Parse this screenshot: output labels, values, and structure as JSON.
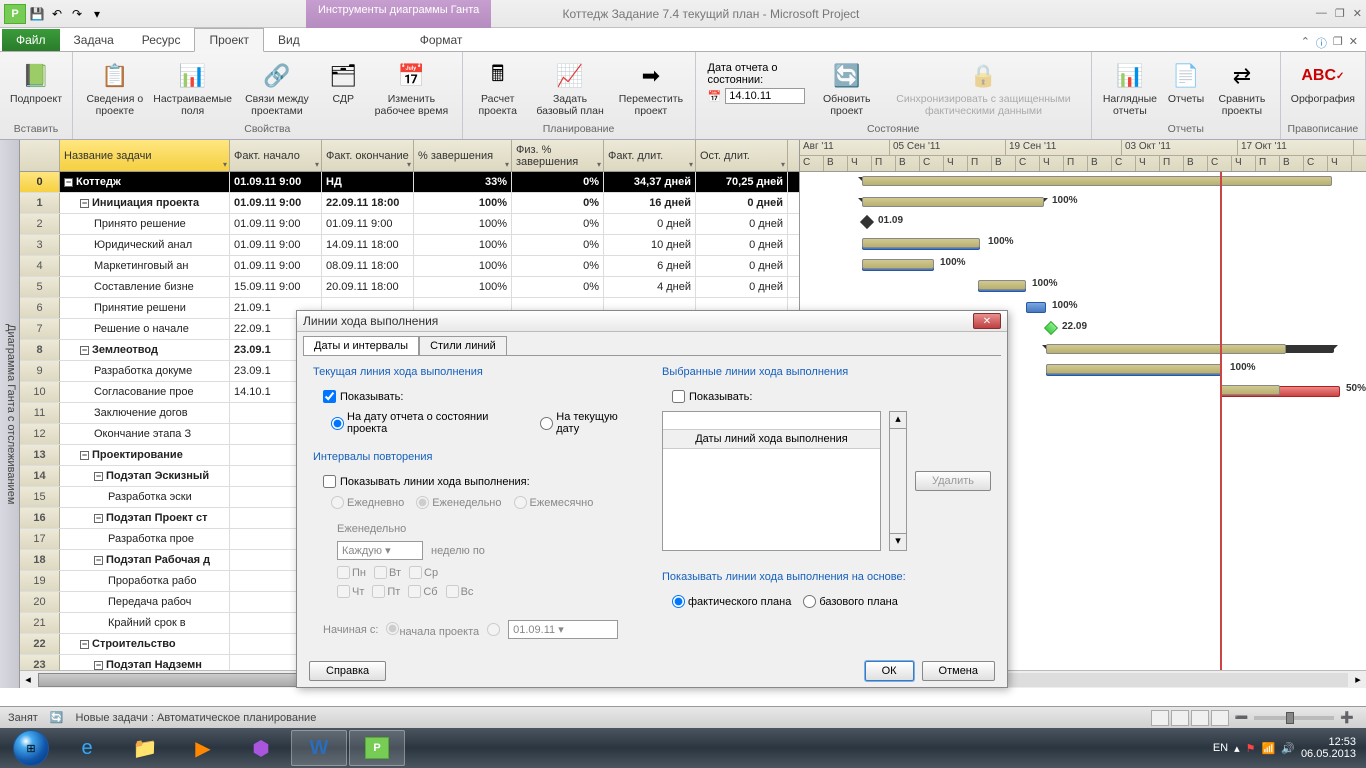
{
  "title": "Коттедж Задание 7.4 текущий план - Microsoft Project",
  "context_tab": "Инструменты диаграммы Ганта",
  "tabs": {
    "file": "Файл",
    "task": "Задача",
    "resource": "Ресурс",
    "project": "Проект",
    "view": "Вид",
    "format": "Формат"
  },
  "ribbon": {
    "insert_group": "Вставить",
    "subproject": "Подпроект",
    "props_group": "Свойства",
    "info": "Сведения о проекте",
    "custom_fields": "Настраиваемые поля",
    "links": "Связи между проектами",
    "wbs": "СДР",
    "change_time": "Изменить рабочее время",
    "plan_group": "Планирование",
    "calc": "Расчет проекта",
    "baseline": "Задать базовый план",
    "move": "Переместить проект",
    "status_label": "Дата отчета о состоянии:",
    "status_date": "14.10.11",
    "status_group": "Состояние",
    "update": "Обновить проект",
    "sync": "Синхронизировать с защищенными фактическими данными",
    "reports_group": "Отчеты",
    "visual": "Наглядные отчеты",
    "reports": "Отчеты",
    "compare": "Сравнить проекты",
    "spell_group": "Правописание",
    "spell": "Орфография"
  },
  "sidebar": "Диаграмма Ганта с отслеживанием",
  "columns": {
    "name": "Название задачи",
    "c1": "Факт. начало",
    "c2": "Факт. окончание",
    "c3": "% завершения",
    "c4": "Физ. % завершения",
    "c5": "Факт. длит.",
    "c6": "Ост. длит."
  },
  "rows": [
    {
      "n": "0",
      "name": "Коттедж",
      "c1": "01.09.11 9:00",
      "c2": "НД",
      "c3": "33%",
      "c4": "0%",
      "c5": "34,37 дней",
      "c6": "70,25 дней",
      "lvl": 0,
      "sum": true,
      "black": true
    },
    {
      "n": "1",
      "name": "Инициация проекта",
      "c1": "01.09.11 9:00",
      "c2": "22.09.11 18:00",
      "c3": "100%",
      "c4": "0%",
      "c5": "16 дней",
      "c6": "0 дней",
      "lvl": 1,
      "sum": true
    },
    {
      "n": "2",
      "name": "Принято решение",
      "c1": "01.09.11 9:00",
      "c2": "01.09.11 9:00",
      "c3": "100%",
      "c4": "0%",
      "c5": "0 дней",
      "c6": "0 дней",
      "lvl": 2
    },
    {
      "n": "3",
      "name": "Юридический анал",
      "c1": "01.09.11 9:00",
      "c2": "14.09.11 18:00",
      "c3": "100%",
      "c4": "0%",
      "c5": "10 дней",
      "c6": "0 дней",
      "lvl": 2
    },
    {
      "n": "4",
      "name": "Маркетинговый ан",
      "c1": "01.09.11 9:00",
      "c2": "08.09.11 18:00",
      "c3": "100%",
      "c4": "0%",
      "c5": "6 дней",
      "c6": "0 дней",
      "lvl": 2
    },
    {
      "n": "5",
      "name": "Составление бизне",
      "c1": "15.09.11 9:00",
      "c2": "20.09.11 18:00",
      "c3": "100%",
      "c4": "0%",
      "c5": "4 дней",
      "c6": "0 дней",
      "lvl": 2
    },
    {
      "n": "6",
      "name": "Принятие решени",
      "c1": "21.09.1",
      "c2": "",
      "c3": "",
      "c4": "",
      "c5": "",
      "c6": "",
      "lvl": 2
    },
    {
      "n": "7",
      "name": "Решение о начале",
      "c1": "22.09.1",
      "c2": "",
      "c3": "",
      "c4": "",
      "c5": "",
      "c6": "",
      "lvl": 2
    },
    {
      "n": "8",
      "name": "Землеотвод",
      "c1": "23.09.1",
      "c2": "",
      "c3": "",
      "c4": "",
      "c5": "",
      "c6": "",
      "lvl": 1,
      "sum": true
    },
    {
      "n": "9",
      "name": "Разработка докуме",
      "c1": "23.09.1",
      "c2": "",
      "c3": "",
      "c4": "",
      "c5": "",
      "c6": "",
      "lvl": 2
    },
    {
      "n": "10",
      "name": "Согласование прое",
      "c1": "14.10.1",
      "c2": "",
      "c3": "",
      "c4": "",
      "c5": "",
      "c6": "",
      "lvl": 2
    },
    {
      "n": "11",
      "name": "Заключение догов",
      "c1": "",
      "c2": "",
      "c3": "",
      "c4": "",
      "c5": "",
      "c6": "",
      "lvl": 2
    },
    {
      "n": "12",
      "name": "Окончание этапа З",
      "c1": "",
      "c2": "",
      "c3": "",
      "c4": "",
      "c5": "",
      "c6": "",
      "lvl": 2
    },
    {
      "n": "13",
      "name": "Проектирование",
      "c1": "",
      "c2": "",
      "c3": "",
      "c4": "",
      "c5": "",
      "c6": "",
      "lvl": 1,
      "sum": true
    },
    {
      "n": "14",
      "name": "Подэтап Эскизный",
      "c1": "",
      "c2": "",
      "c3": "",
      "c4": "",
      "c5": "",
      "c6": "",
      "lvl": 2,
      "sum": true
    },
    {
      "n": "15",
      "name": "Разработка эски",
      "c1": "",
      "c2": "",
      "c3": "",
      "c4": "",
      "c5": "",
      "c6": "",
      "lvl": 3
    },
    {
      "n": "16",
      "name": "Подэтап Проект ст",
      "c1": "",
      "c2": "",
      "c3": "",
      "c4": "",
      "c5": "",
      "c6": "",
      "lvl": 2,
      "sum": true
    },
    {
      "n": "17",
      "name": "Разработка прое",
      "c1": "",
      "c2": "",
      "c3": "",
      "c4": "",
      "c5": "",
      "c6": "",
      "lvl": 3
    },
    {
      "n": "18",
      "name": "Подэтап Рабочая д",
      "c1": "",
      "c2": "",
      "c3": "",
      "c4": "",
      "c5": "",
      "c6": "",
      "lvl": 2,
      "sum": true
    },
    {
      "n": "19",
      "name": "Проработка рабо",
      "c1": "",
      "c2": "",
      "c3": "",
      "c4": "",
      "c5": "",
      "c6": "",
      "lvl": 3
    },
    {
      "n": "20",
      "name": "Передача рабоч",
      "c1": "",
      "c2": "",
      "c3": "",
      "c4": "",
      "c5": "",
      "c6": "",
      "lvl": 3
    },
    {
      "n": "21",
      "name": "Крайний срок в",
      "c1": "",
      "c2": "",
      "c3": "",
      "c4": "",
      "c5": "",
      "c6": "",
      "lvl": 3
    },
    {
      "n": "22",
      "name": "Строительство",
      "c1": "",
      "c2": "",
      "c3": "",
      "c4": "",
      "c5": "",
      "c6": "",
      "lvl": 1,
      "sum": true
    },
    {
      "n": "23",
      "name": "Подэтап Надземн",
      "c1": "",
      "c2": "",
      "c3": "",
      "c4": "",
      "c5": "",
      "c6": "",
      "lvl": 2,
      "sum": true
    }
  ],
  "timeline": {
    "months": [
      "Авг '11",
      "05 Сен '11",
      "19 Сен '11",
      "03 Окт '11",
      "17 Окт '11"
    ],
    "days": [
      "С",
      "В",
      "Ч",
      "П",
      "В",
      "С",
      "Ч",
      "П",
      "В",
      "С",
      "Ч",
      "П",
      "В",
      "С",
      "Ч",
      "П",
      "В",
      "С",
      "Ч",
      "П",
      "В",
      "С",
      "Ч"
    ],
    "labels": {
      "ms1": "01.09",
      "ms2": "22.09",
      "p100": "100%",
      "p50": "50%"
    }
  },
  "dialog": {
    "title": "Линии хода выполнения",
    "tab1": "Даты и интервалы",
    "tab2": "Стили линий",
    "sec1": "Текущая линия хода выполнения",
    "show": "Показывать:",
    "r1": "На дату отчета о состоянии проекта",
    "r2": "На текущую дату",
    "sec2": "Интервалы повторения",
    "show_lines": "Показывать линии хода выполнения:",
    "daily": "Ежедневно",
    "weekly": "Еженедельно",
    "monthly": "Ежемесячно",
    "weekly_title": "Еженедельно",
    "every": "Каждую",
    "week_on": "неделю по",
    "mon": "Пн",
    "tue": "Вт",
    "wed": "Ср",
    "thu": "Чт",
    "fri": "Пт",
    "sat": "Сб",
    "sun": "Вс",
    "starting": "Начиная с:",
    "proj_start": "начала проекта",
    "start_date": "01.09.11",
    "sec3": "Выбранные линии хода выполнения",
    "list_head": "Даты линий хода выполнения",
    "delete": "Удалить",
    "sec4": "Показывать линии хода выполнения на основе:",
    "actual": "фактического плана",
    "baseline": "базового плана",
    "help": "Справка",
    "ok": "ОК",
    "cancel": "Отмена"
  },
  "statusbar": {
    "busy": "Занят",
    "newtasks": "Новые задачи : Автоматическое планирование"
  },
  "tray": {
    "lang": "EN",
    "time": "12:53",
    "date": "06.05.2013"
  }
}
